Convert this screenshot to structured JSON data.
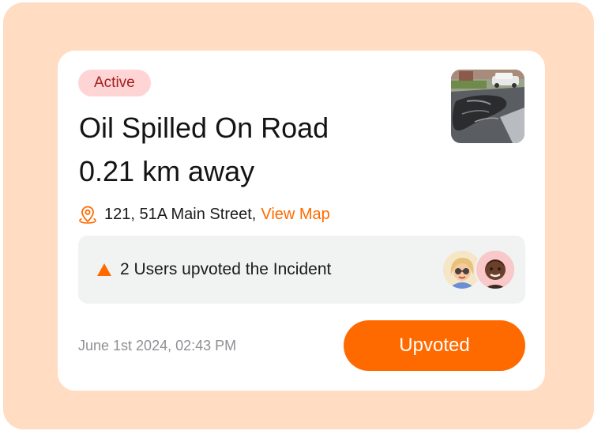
{
  "incident": {
    "status": "Active",
    "title": "Oil Spilled On Road",
    "distance": "0.21 km away",
    "address": "121, 51A Main Street,",
    "view_map_label": "View Map",
    "upvote_text": "2 Users upvoted the Incident",
    "timestamp": "June 1st 2024, 02:43 PM",
    "upvoted_button_label": "Upvoted"
  },
  "colors": {
    "accent": "#ff6a00",
    "background": "#ffdcc2",
    "badge_bg": "#ffd4d4",
    "badge_text": "#a01f1f"
  },
  "icons": {
    "location": "location-pin-icon",
    "upvote": "upvote-triangle-icon"
  }
}
